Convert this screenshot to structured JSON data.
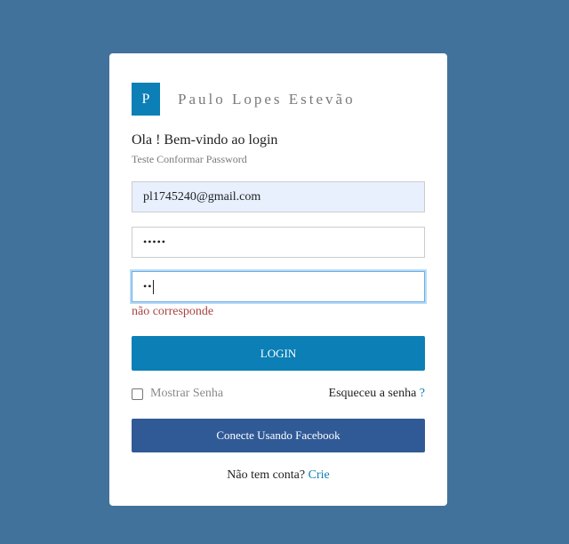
{
  "brand": {
    "logo_letter": "P",
    "name": "Paulo Lopes Estevão"
  },
  "header": {
    "welcome": "Ola ! Bem-vindo ao login",
    "subtitle": "Teste Conformar Password"
  },
  "form": {
    "email_value": "pl1745240@gmail.com",
    "password_masked": "•••••",
    "confirm_masked": "••",
    "error_text": "não corresponde",
    "login_label": "LOGIN",
    "show_password_label": "Mostrar Senha",
    "show_password_checked": false,
    "forgot_label": "Esqueceu a senha",
    "forgot_mark": "?",
    "facebook_label": "Conecte Usando Facebook",
    "signup_prompt": "Não tem conta?",
    "signup_link": "Crie"
  },
  "colors": {
    "background": "#41729b",
    "primary": "#0b7fb6",
    "facebook": "#305a96",
    "error": "#a94442"
  }
}
